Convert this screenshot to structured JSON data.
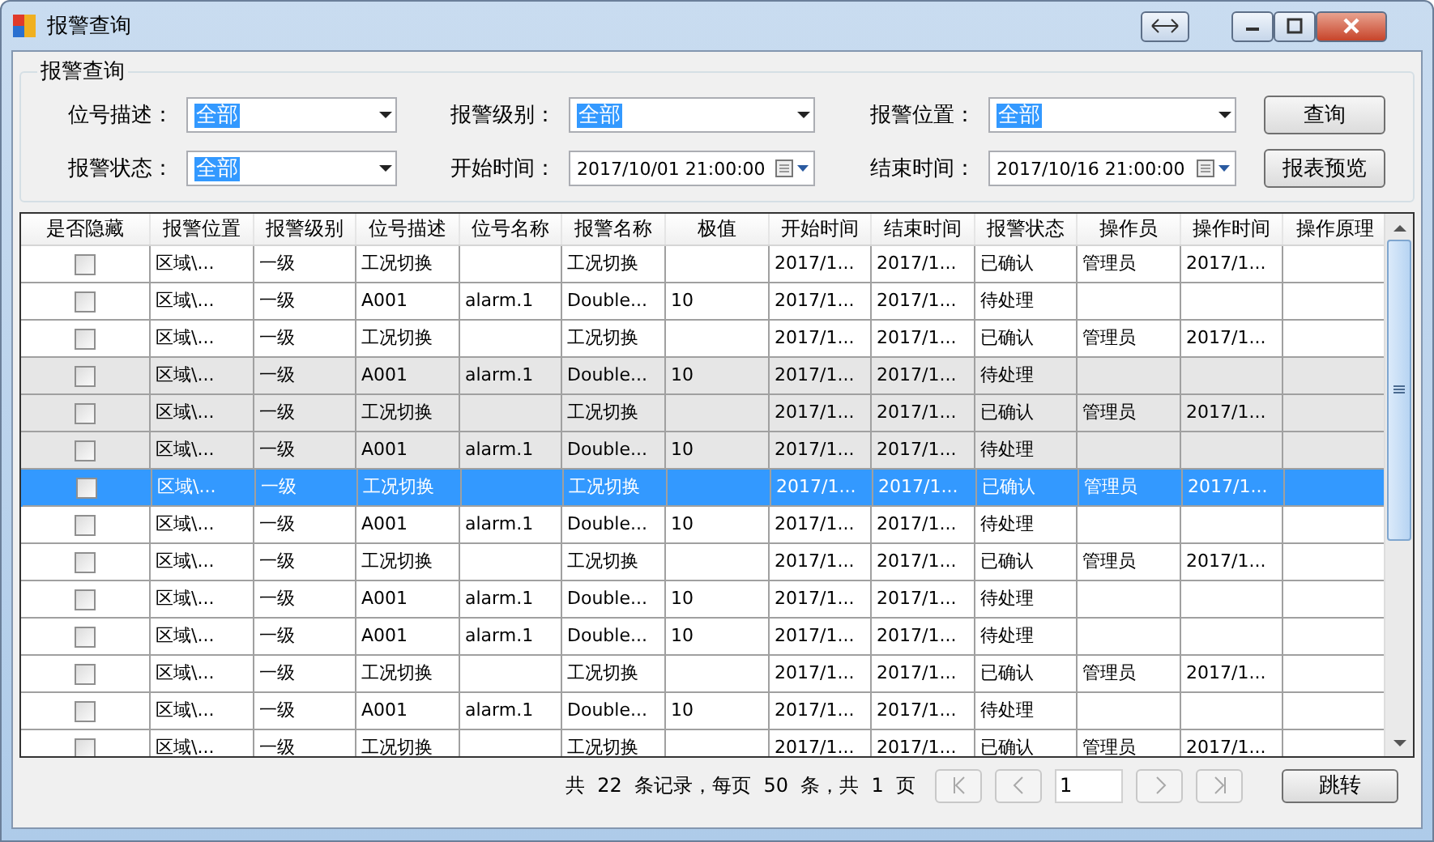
{
  "window": {
    "title": "报警查询"
  },
  "query": {
    "title": "报警查询",
    "filters": [
      {
        "kind": "combo",
        "label": "位号描述：",
        "value": "全部"
      },
      {
        "kind": "combo",
        "label": "报警级别：",
        "value": "全部"
      },
      {
        "kind": "combo",
        "label": "报警位置：",
        "value": "全部"
      },
      {
        "kind": "combo",
        "label": "报警状态：",
        "value": "全部"
      },
      {
        "kind": "date",
        "label": "开始时间：",
        "value": "2017/10/01 21:00:00"
      },
      {
        "kind": "date",
        "label": "结束时间：",
        "value": "2017/10/16 21:00:00"
      }
    ],
    "buttons": [
      "查询",
      "报表预览"
    ]
  },
  "table": {
    "columns": [
      "是否隐藏",
      "报警位置",
      "报警级别",
      "位号描述",
      "位号名称",
      "报警名称",
      "极值",
      "开始时间",
      "结束时间",
      "报警状态",
      "操作员",
      "操作时间",
      "操作原理"
    ],
    "rows": [
      {
        "selected": false,
        "shaded": false,
        "cells": [
          {
            "checked": false
          },
          "区域\\...",
          "一级",
          "工况切换",
          null,
          "工况切换",
          null,
          "2017/1...",
          "2017/1...",
          "已确认",
          "管理员",
          "2017/1...",
          null
        ]
      },
      {
        "selected": false,
        "shaded": false,
        "cells": [
          {
            "checked": false
          },
          "区域\\...",
          "一级",
          "A001",
          "alarm.1",
          "Double...",
          "10",
          "2017/1...",
          "2017/1...",
          "待处理",
          null,
          null,
          null
        ]
      },
      {
        "selected": false,
        "shaded": false,
        "cells": [
          {
            "checked": false
          },
          "区域\\...",
          "一级",
          "工况切换",
          null,
          "工况切换",
          null,
          "2017/1...",
          "2017/1...",
          "已确认",
          "管理员",
          "2017/1...",
          null
        ]
      },
      {
        "selected": false,
        "shaded": true,
        "cells": [
          {
            "checked": false
          },
          "区域\\...",
          "一级",
          "A001",
          "alarm.1",
          "Double...",
          "10",
          "2017/1...",
          "2017/1...",
          "待处理",
          null,
          null,
          null
        ]
      },
      {
        "selected": false,
        "shaded": true,
        "cells": [
          {
            "checked": false
          },
          "区域\\...",
          "一级",
          "工况切换",
          null,
          "工况切换",
          null,
          "2017/1...",
          "2017/1...",
          "已确认",
          "管理员",
          "2017/1...",
          null
        ]
      },
      {
        "selected": false,
        "shaded": true,
        "cells": [
          {
            "checked": false
          },
          "区域\\...",
          "一级",
          "A001",
          "alarm.1",
          "Double...",
          "10",
          "2017/1...",
          "2017/1...",
          "待处理",
          null,
          null,
          null
        ]
      },
      {
        "selected": true,
        "shaded": false,
        "cells": [
          {
            "checked": false
          },
          "区域\\...",
          "一级",
          "工况切换",
          null,
          "工况切换",
          null,
          "2017/1...",
          "2017/1...",
          "已确认",
          "管理员",
          "2017/1...",
          null
        ]
      },
      {
        "selected": false,
        "shaded": false,
        "cells": [
          {
            "checked": false
          },
          "区域\\...",
          "一级",
          "A001",
          "alarm.1",
          "Double...",
          "10",
          "2017/1...",
          "2017/1...",
          "待处理",
          null,
          null,
          null
        ]
      },
      {
        "selected": false,
        "shaded": false,
        "cells": [
          {
            "checked": false
          },
          "区域\\...",
          "一级",
          "工况切换",
          null,
          "工况切换",
          null,
          "2017/1...",
          "2017/1...",
          "已确认",
          "管理员",
          "2017/1...",
          null
        ]
      },
      {
        "selected": false,
        "shaded": false,
        "cells": [
          {
            "checked": false
          },
          "区域\\...",
          "一级",
          "A001",
          "alarm.1",
          "Double...",
          "10",
          "2017/1...",
          "2017/1...",
          "待处理",
          null,
          null,
          null
        ]
      },
      {
        "selected": false,
        "shaded": false,
        "cells": [
          {
            "checked": false
          },
          "区域\\...",
          "一级",
          "A001",
          "alarm.1",
          "Double...",
          "10",
          "2017/1...",
          "2017/1...",
          "待处理",
          null,
          null,
          null
        ]
      },
      {
        "selected": false,
        "shaded": false,
        "cells": [
          {
            "checked": false
          },
          "区域\\...",
          "一级",
          "工况切换",
          null,
          "工况切换",
          null,
          "2017/1...",
          "2017/1...",
          "已确认",
          "管理员",
          "2017/1...",
          null
        ]
      },
      {
        "selected": false,
        "shaded": false,
        "cells": [
          {
            "checked": false
          },
          "区域\\...",
          "一级",
          "A001",
          "alarm.1",
          "Double...",
          "10",
          "2017/1...",
          "2017/1...",
          "待处理",
          null,
          null,
          null
        ]
      },
      {
        "selected": false,
        "shaded": false,
        "cells": [
          {
            "checked": false
          },
          "区域\\...",
          "一级",
          "工况切换",
          null,
          "工况切换",
          null,
          "2017/1...",
          "2017/1...",
          "已确认",
          "管理员",
          "2017/1...",
          null
        ]
      }
    ]
  },
  "pager": {
    "summary": "共  22  条记录，每页  50  条，共  1  页",
    "page": "1",
    "jump": "跳转"
  }
}
